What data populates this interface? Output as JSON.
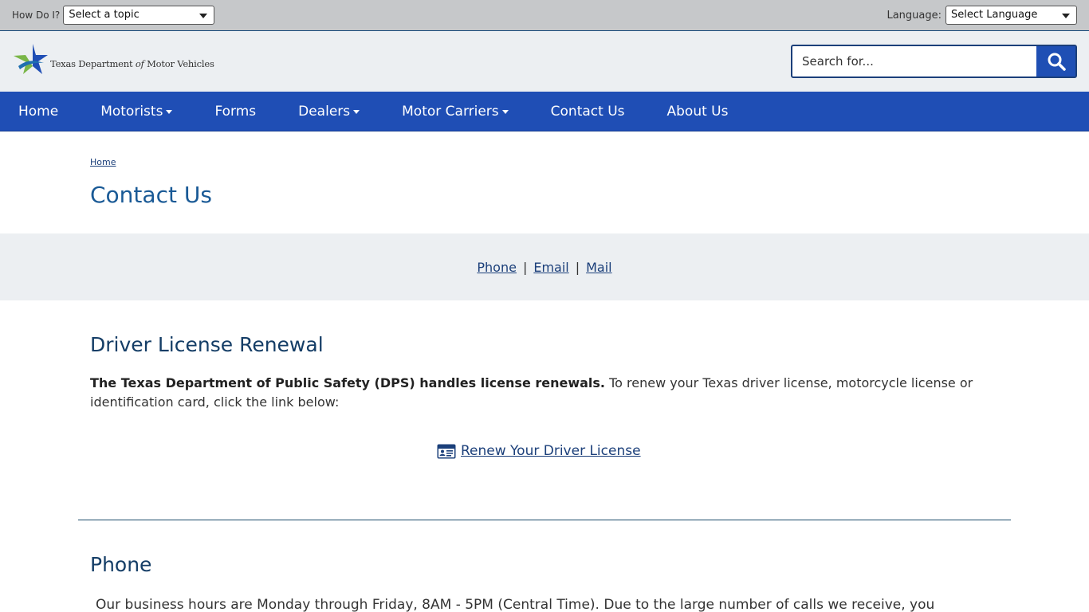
{
  "utility": {
    "how_label": "How Do I?",
    "topic_value": "Select a topic",
    "language_label": "Language:",
    "language_value": "Select Language"
  },
  "header": {
    "logo_text_prefix": "Texas Department ",
    "logo_text_of": "of",
    "logo_text_suffix": " Motor Vehicles",
    "search_placeholder": "Search for..."
  },
  "nav": {
    "items": [
      {
        "label": "Home"
      },
      {
        "label": "Motorists"
      },
      {
        "label": "Forms"
      },
      {
        "label": "Dealers"
      },
      {
        "label": "Motor Carriers"
      },
      {
        "label": "Contact Us"
      },
      {
        "label": "About Us"
      }
    ]
  },
  "breadcrumb": {
    "home": "Home"
  },
  "page": {
    "title": "Contact Us"
  },
  "jump": {
    "phone": "Phone",
    "email": "Email",
    "mail": "Mail",
    "sep": "|"
  },
  "renewal": {
    "title": "Driver License Renewal",
    "bold": "The Texas Department of Public Safety (DPS) handles license renewals.",
    "text": " To renew your Texas driver license, motorcycle license or identification card, click the link below:",
    "link": " Renew Your Driver License"
  },
  "phone": {
    "title": "Phone",
    "hours": "Our business hours are Monday through Friday, 8AM - 5PM (Central Time). Due to the large number of calls we receive, you"
  },
  "colors": {
    "nav": "#1f4eb5",
    "header": "#eceff2",
    "title": "#1a5a96",
    "link": "#1b3f7a"
  }
}
